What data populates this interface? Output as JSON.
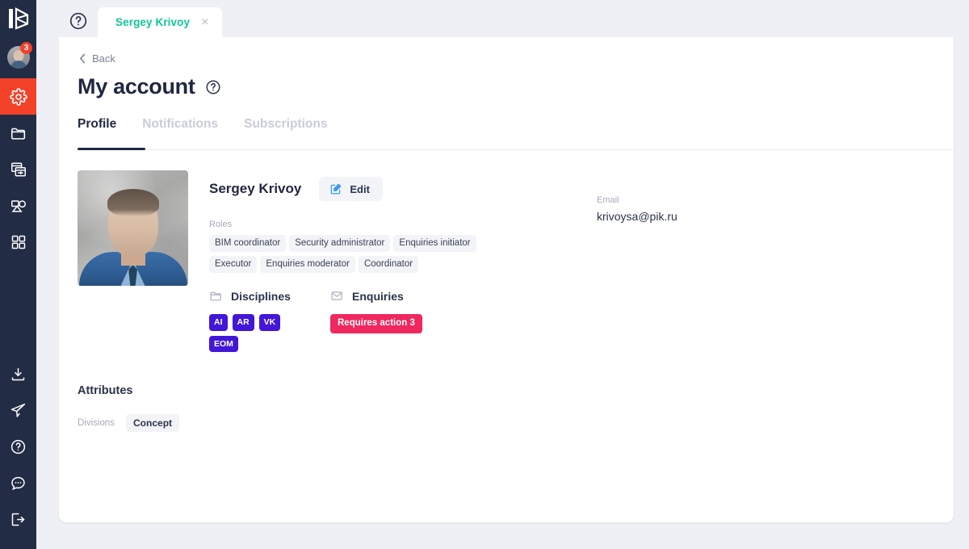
{
  "app": {
    "logo_name": "k-logo",
    "accent_red": "#f4412a",
    "accent_teal": "#0ec79a",
    "sidebar_bg": "#222c44",
    "tag_purple": "#4416d8",
    "badge_pink": "#f0285f"
  },
  "sidebar": {
    "avatar_badge_count": "3",
    "items": [
      {
        "name": "settings",
        "icon": "gear-icon",
        "active": true
      },
      {
        "name": "folder",
        "icon": "folder-icon",
        "active": false
      },
      {
        "name": "documents",
        "icon": "documents-icon",
        "active": false
      },
      {
        "name": "models",
        "icon": "models-icon",
        "active": false
      },
      {
        "name": "apps",
        "icon": "grid-apps-icon",
        "active": false
      }
    ],
    "bottom_items": [
      {
        "name": "download",
        "icon": "download-icon"
      },
      {
        "name": "send",
        "icon": "paper-plane-icon"
      },
      {
        "name": "help",
        "icon": "question-circle-icon"
      },
      {
        "name": "chat",
        "icon": "chat-bubble-icon"
      },
      {
        "name": "logout",
        "icon": "logout-icon"
      }
    ]
  },
  "topbar": {
    "help_icon": "question-circle-icon",
    "tab_label": "Sergey Krivoy",
    "tab_close_glyph": "×",
    "window_close_icon": "close-icon"
  },
  "page": {
    "back_label": "Back",
    "title": "My account",
    "title_help_icon": "question-circle-icon",
    "tabs": [
      {
        "label": "Profile",
        "active": true
      },
      {
        "label": "Notifications",
        "active": false
      },
      {
        "label": "Subscriptions",
        "active": false
      }
    ]
  },
  "profile": {
    "photo_alt": "profile-photo",
    "name": "Sergey Krivoy",
    "edit_label": "Edit",
    "edit_icon": "edit-square-icon",
    "roles_label": "Roles",
    "roles": [
      "BIM coordinator",
      "Security administrator",
      "Enquiries initiator",
      "Executor",
      "Enquiries moderator",
      "Coordinator"
    ],
    "email_label": "Email",
    "email_value": "krivoysa@pik.ru",
    "disciplines_label": "Disciplines",
    "disciplines_icon": "folder-outline-icon",
    "disciplines": [
      "AI",
      "AR",
      "VK",
      "EOM"
    ],
    "enquiries_label": "Enquiries",
    "enquiries_icon": "envelope-icon",
    "enquiries_badge": "Requires action 3"
  },
  "attributes": {
    "title": "Attributes",
    "rows": [
      {
        "key": "Divisions",
        "value": "Concept"
      }
    ]
  }
}
